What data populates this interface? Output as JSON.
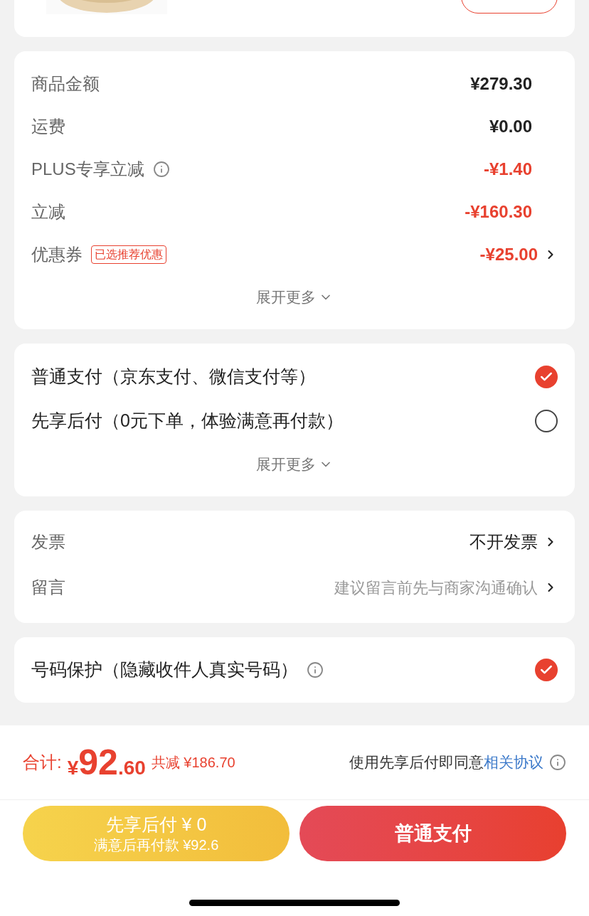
{
  "summary": {
    "rows": [
      {
        "label": "商品金额",
        "value": "¥279.30",
        "kind": "plain",
        "info": false,
        "arrow": false
      },
      {
        "label": "运费",
        "value": "¥0.00",
        "kind": "plain",
        "info": false,
        "arrow": false
      },
      {
        "label": "PLUS专享立减",
        "value": "-¥1.40",
        "kind": "discount",
        "info": true,
        "arrow": false
      },
      {
        "label": "立减",
        "value": "-¥160.30",
        "kind": "discount",
        "info": false,
        "arrow": false
      },
      {
        "label": "优惠券",
        "tag": "已选推荐优惠",
        "value": "-¥25.00",
        "kind": "discount",
        "info": false,
        "arrow": true
      }
    ],
    "expand": "展开更多"
  },
  "payment": {
    "options": [
      {
        "label": "普通支付（京东支付、微信支付等）",
        "selected": true
      },
      {
        "label": "先享后付（0元下单，体验满意再付款）",
        "selected": false
      }
    ],
    "expand": "展开更多"
  },
  "extras": [
    {
      "label": "发票",
      "value": "不开发票"
    },
    {
      "label": "留言",
      "placeholder": "建议留言前先与商家沟通确认"
    }
  ],
  "number_protection": {
    "label": "号码保护（隐藏收件人真实号码）",
    "checked": true
  },
  "footer": {
    "total_label": "合计:",
    "currency": "¥",
    "total_int": "92",
    "total_dec": ".60",
    "saved": "共减 ¥186.70",
    "agreement_text": "使用先享后付即同意",
    "agreement_link": "相关协议",
    "buttons": [
      {
        "kind": "later",
        "title": "先享后付 ¥ 0",
        "subtitle": "满意后再付款 ¥92.6"
      },
      {
        "kind": "normal",
        "title": "普通支付"
      }
    ]
  }
}
